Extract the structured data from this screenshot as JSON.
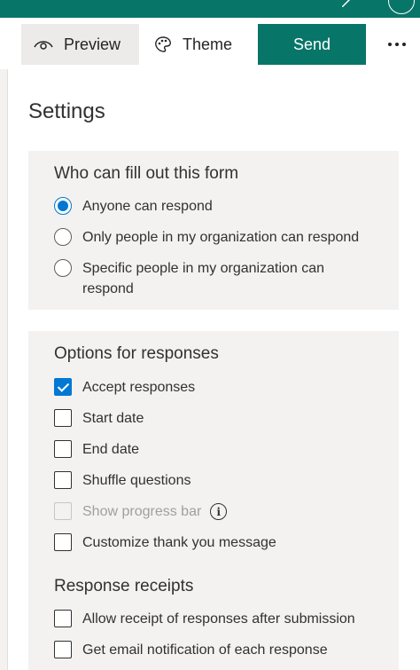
{
  "toolbar": {
    "preview_label": "Preview",
    "theme_label": "Theme",
    "send_label": "Send"
  },
  "settings": {
    "title": "Settings",
    "who": {
      "title": "Who can fill out this form",
      "options": [
        {
          "label": "Anyone can respond",
          "selected": true
        },
        {
          "label": "Only people in my organization can respond",
          "selected": false
        },
        {
          "label": "Specific people in my organization can respond",
          "selected": false
        }
      ]
    },
    "responses": {
      "title": "Options for responses",
      "options": [
        {
          "label": "Accept responses",
          "checked": true,
          "enabled": true
        },
        {
          "label": "Start date",
          "checked": false,
          "enabled": true
        },
        {
          "label": "End date",
          "checked": false,
          "enabled": true
        },
        {
          "label": "Shuffle questions",
          "checked": false,
          "enabled": true
        },
        {
          "label": "Show progress bar",
          "checked": false,
          "enabled": false
        },
        {
          "label": "Customize thank you message",
          "checked": false,
          "enabled": true
        }
      ]
    },
    "receipts": {
      "title": "Response receipts",
      "options": [
        {
          "label": "Allow receipt of responses after submission",
          "checked": false
        },
        {
          "label": "Get email notification of each response",
          "checked": false
        }
      ]
    }
  },
  "colors": {
    "brand": "#077568",
    "accent": "#0078d4",
    "panel": "#f3f2f1"
  }
}
